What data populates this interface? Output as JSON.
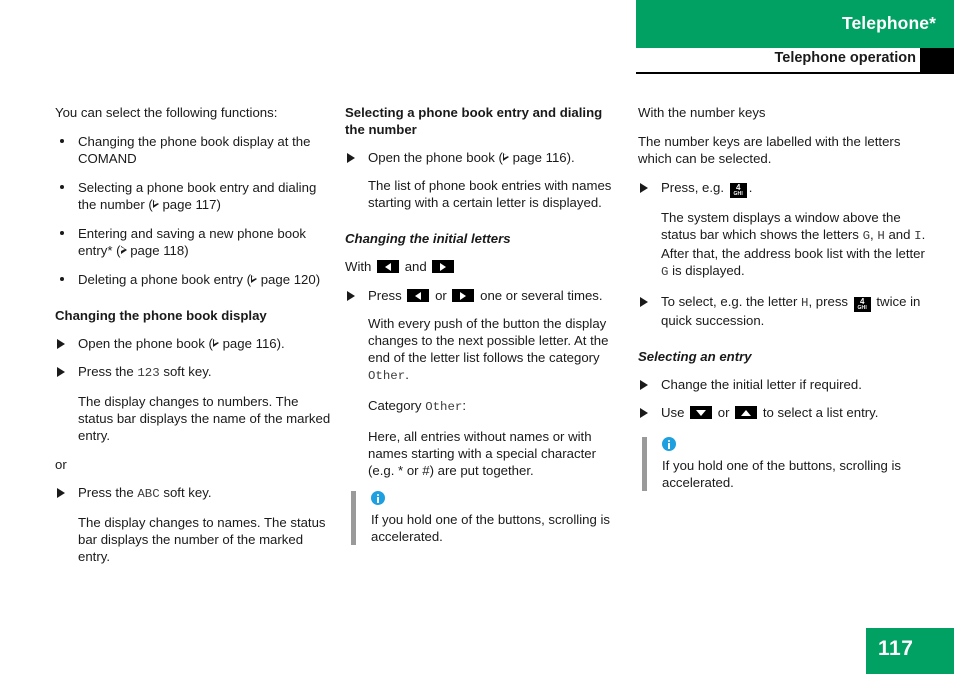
{
  "header": {
    "title": "Telephone*",
    "subtitle": "Telephone operation",
    "green": "#00a163"
  },
  "footer": {
    "page_number": "117"
  },
  "col1": {
    "intro": "You can select the following functions:",
    "bullets": [
      {
        "pre": "Changing the phone book display at the COMAND",
        "ref": ""
      },
      {
        "pre": "Selecting a phone book entry and dialing the number (",
        "ref": "page 117",
        "post": ")"
      },
      {
        "pre": "Entering and saving a new phone book entry* (",
        "ref": "page 118",
        "post": ")"
      },
      {
        "pre": "Deleting a phone book entry (",
        "ref": "page 120",
        "post": ")"
      }
    ],
    "heading": "Changing the phone book display",
    "step1_pre": "Open the phone book (",
    "step1_ref": "page 116",
    "step1_post": ").",
    "step2_pre": "Press the ",
    "step2_key": "123",
    "step2_post": " soft key.",
    "body1": "The display changes to numbers. The status bar displays the name of the marked entry.",
    "or": "or",
    "step3_pre": "Press the ",
    "step3_key": "ABC",
    "step3_post": " soft key.",
    "body2": "The display changes to names. The status bar displays the number of the marked entry."
  },
  "col2": {
    "heading": "Selecting a phone book entry and dialing the number",
    "step1_pre": "Open the phone book (",
    "step1_ref": "page 116",
    "step1_post": ").",
    "body1": "The list of phone book entries with names starting with a certain letter is displayed.",
    "subheading": "Changing the initial letters",
    "with_pre": "With",
    "with_mid": "and",
    "press_pre": "Press",
    "press_mid": "or",
    "press_post": "one or several times.",
    "body2_pre": "With every push of the button the display changes to the next possible letter. At the end of the letter list follows the category ",
    "body2_mono": "Other",
    "body2_post": ".",
    "body3_pre": "Category ",
    "body3_mono": "Other",
    "body3_post": ":",
    "body4": "Here, all entries without names or with names starting with a special character (e.g. * or #) are put together.",
    "note": "If you hold one of the buttons, scrolling is accelerated."
  },
  "col3": {
    "heading": "With the number keys",
    "body1": "The number keys are labelled with the letters which can be selected.",
    "step1_pre": "Press, e.g.",
    "step1_post": ".",
    "key_num": "4",
    "key_letters": "GHI",
    "body2_p1": "The system displays a window above the status bar which shows the letters ",
    "body2_m1": "G",
    "body2_p2": ", ",
    "body2_m2": "H",
    "body2_p3": " and ",
    "body2_m3": "I",
    "body2_p4": ". After that, the address book list with the letter ",
    "body2_m4": "G",
    "body2_p5": " is displayed.",
    "step2_p1": "To select, e.g. the letter ",
    "step2_m1": "H",
    "step2_p2": ", press",
    "step2_p3": "twice in quick succession.",
    "subheading": "Selecting an entry",
    "step3": "Change the initial letter if required.",
    "step4_pre": "Use",
    "step4_mid": "or",
    "step4_post": "to select a list entry.",
    "note": "If you hold one of the buttons, scrolling is accelerated."
  }
}
